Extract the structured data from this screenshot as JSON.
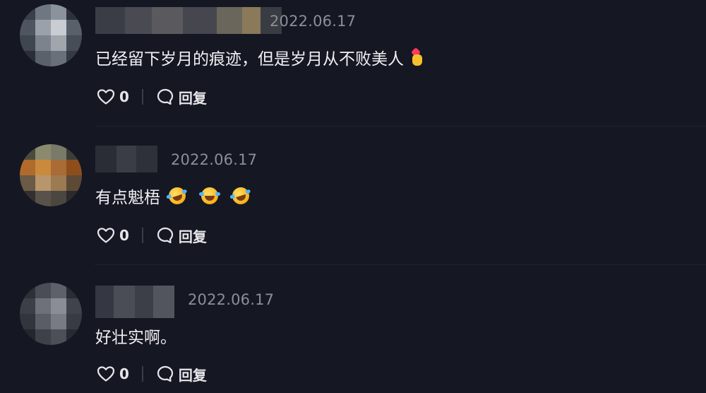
{
  "comments": [
    {
      "date": "2022.06.17",
      "text": "已经留下岁月的痕迹，但是岁月从不败美人",
      "emoji": "heart-hand",
      "likes": "0",
      "reply_label": "回复"
    },
    {
      "date": "2022.06.17",
      "text": "有点魁梧",
      "emoji": "laughing-tears",
      "likes": "0",
      "reply_label": "回复"
    },
    {
      "date": "2022.06.17",
      "text": "好壮实啊。",
      "likes": "0",
      "reply_label": "回复"
    }
  ],
  "colors": {
    "background": "#151722",
    "date": "#8c8e98",
    "text": "#f0f0f4"
  }
}
